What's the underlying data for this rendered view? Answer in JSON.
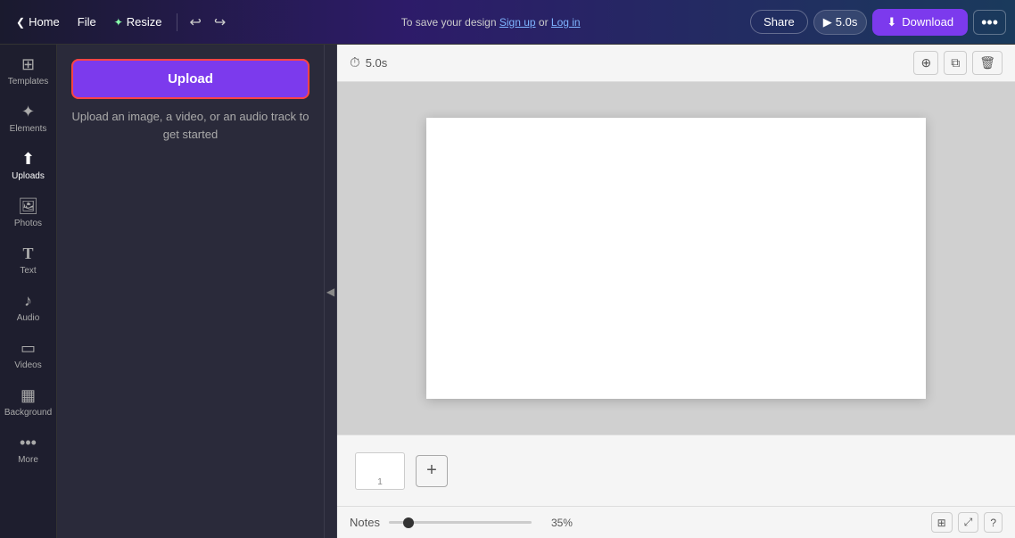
{
  "topnav": {
    "home_label": "Home",
    "file_label": "File",
    "resize_label": "Resize",
    "save_prompt": "To save your design ",
    "signup_label": "Sign up",
    "or_label": " or ",
    "login_label": "Log in",
    "share_label": "Share",
    "play_duration": "5.0s",
    "download_label": "Download",
    "more_label": "•••"
  },
  "sidebar": {
    "items": [
      {
        "id": "templates",
        "label": "Templates",
        "icon": "⊞"
      },
      {
        "id": "elements",
        "label": "Elements",
        "icon": "✦"
      },
      {
        "id": "uploads",
        "label": "Uploads",
        "icon": "⬆"
      },
      {
        "id": "photos",
        "label": "Photos",
        "icon": "🖼"
      },
      {
        "id": "text",
        "label": "Text",
        "icon": "T"
      },
      {
        "id": "audio",
        "label": "Audio",
        "icon": "♪"
      },
      {
        "id": "videos",
        "label": "Videos",
        "icon": "▭"
      },
      {
        "id": "background",
        "label": "Background",
        "icon": "▦"
      },
      {
        "id": "more",
        "label": "More",
        "icon": "•••"
      }
    ]
  },
  "panel": {
    "upload_btn_label": "Upload",
    "upload_hint": "Upload an image, a video, or an\naudio track to get started"
  },
  "canvas": {
    "duration_label": "5.0s",
    "collapse_icon": "◀"
  },
  "pages": {
    "items": [
      {
        "num": "1"
      }
    ],
    "add_label": "+"
  },
  "notes": {
    "label": "Notes",
    "zoom_pct": "35%",
    "fit_label": "⊞",
    "expand_label": "⤢",
    "help_label": "?"
  }
}
